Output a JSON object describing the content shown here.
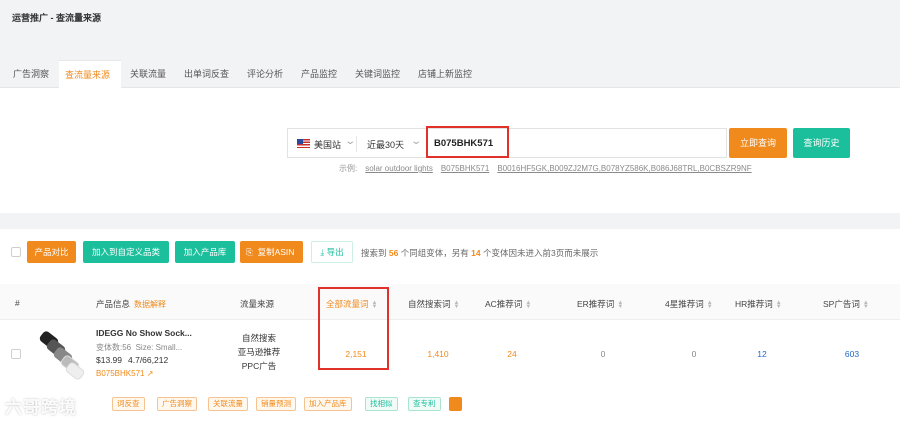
{
  "breadcrumb": "运营推广 - 查流量来源",
  "tabs": [
    {
      "label": "广告洞察",
      "active": false
    },
    {
      "label": "查流量来源",
      "active": true
    },
    {
      "label": "关联流量",
      "active": false
    },
    {
      "label": "出单词反查",
      "active": false
    },
    {
      "label": "评论分析",
      "active": false
    },
    {
      "label": "产品监控",
      "active": false
    },
    {
      "label": "关键词监控",
      "active": false
    },
    {
      "label": "店铺上新监控",
      "active": false
    }
  ],
  "search": {
    "site": "美国站",
    "range": "近最30天",
    "asin_value": "B075BHK571",
    "query_button": "立即查询",
    "history_button": "查询历史",
    "examples_label": "示例:",
    "examples": [
      "solar outdoor lights",
      "B075BHK571",
      "B0016HF5GK,B009ZJ2M7G,B078YZ586K,B086J68TRL,B0CBSZR9NF"
    ]
  },
  "toolbar": {
    "compare": "产品对比",
    "add_custom": "加入到自定义品类",
    "add_library": "加入产品库",
    "copy_asin": "复制ASIN",
    "export": "导出",
    "summary": {
      "pre": "搜索到",
      "count": "56",
      "mid": "个同组变体，另有",
      "extra": "14",
      "post": "个变体因未进入前3页而未展示"
    }
  },
  "columns": {
    "index": "#",
    "product": "产品信息",
    "product_note": "数据解释",
    "source": "流量来源",
    "all": "全部流量词",
    "organic": "自然搜索词",
    "ac": "AC推荐词",
    "er": "ER推荐词",
    "four_star": "4星推荐词",
    "hr": "HR推荐词",
    "sp": "SP广告词"
  },
  "row": {
    "title": "IDEGG No Show Sock...",
    "variants": "变体数:56",
    "size": "Size: Small...",
    "price": "$13.99",
    "rating": "4.7/66,212",
    "asin": "B075BHK571",
    "sources": [
      "自然搜索",
      "亚马逊推荐",
      "PPC广告"
    ],
    "all": "2,151",
    "organic": "1,410",
    "ac": "24",
    "er": "0",
    "four_star": "0",
    "hr": "12",
    "sp": "603"
  },
  "tags": [
    "词反查",
    "广告洞察",
    "关联流量",
    "销量预测",
    "加入产品库",
    "找相似",
    "查专利"
  ],
  "watermark": "六哥跨境",
  "colors": {
    "accent": "#f08a1c",
    "teal": "#1cbf9c",
    "highlight_box": "#e0322b",
    "link_blue": "#1f68c8"
  }
}
